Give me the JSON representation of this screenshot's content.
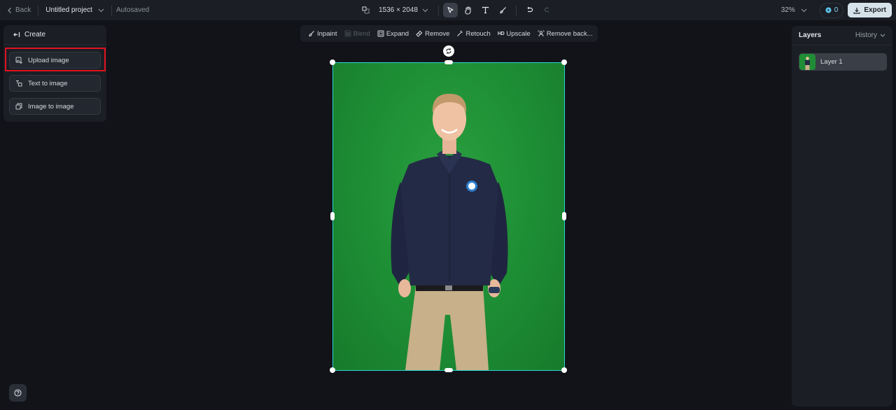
{
  "topbar": {
    "back_label": "Back",
    "project_name": "Untitled project",
    "save_status": "Autosaved",
    "dimensions": "1536 × 2048",
    "zoom_level": "32%",
    "credits": "0",
    "export_label": "Export",
    "tools": [
      {
        "name": "select-tool",
        "icon": "cursor-icon",
        "active": true
      },
      {
        "name": "hand-tool",
        "icon": "hand-icon",
        "active": false
      },
      {
        "name": "text-tool",
        "icon": "text-icon",
        "active": false
      },
      {
        "name": "brush-tool",
        "icon": "brush-icon",
        "active": false
      }
    ]
  },
  "left_panel": {
    "header": "Create",
    "buttons": [
      {
        "label": "Upload image",
        "icon": "upload-image-icon",
        "highlighted": true
      },
      {
        "label": "Text to image",
        "icon": "text-to-image-icon"
      },
      {
        "label": "Image to image",
        "icon": "image-to-image-icon"
      }
    ]
  },
  "context_toolbar": {
    "items": [
      {
        "label": "Inpaint",
        "icon": "inpaint-icon",
        "disabled": false
      },
      {
        "label": "Blend",
        "icon": "blend-icon",
        "disabled": true
      },
      {
        "label": "Expand",
        "icon": "expand-icon",
        "disabled": false
      },
      {
        "label": "Remove",
        "icon": "eraser-icon",
        "disabled": false
      },
      {
        "label": "Retouch",
        "icon": "magic-wand-icon",
        "disabled": false
      },
      {
        "label": "Upscale",
        "icon": "hd-icon",
        "icon_text": "HD",
        "disabled": false
      },
      {
        "label": "Remove back...",
        "icon": "remove-background-icon",
        "disabled": false
      }
    ]
  },
  "right_panel": {
    "title": "Layers",
    "history_label": "History",
    "layers": [
      {
        "name": "Layer 1",
        "selected": true
      }
    ]
  },
  "colors": {
    "accent_selection": "#2dd4d4",
    "highlight": "#e0121e",
    "canvas_green": "#1d8d34"
  }
}
